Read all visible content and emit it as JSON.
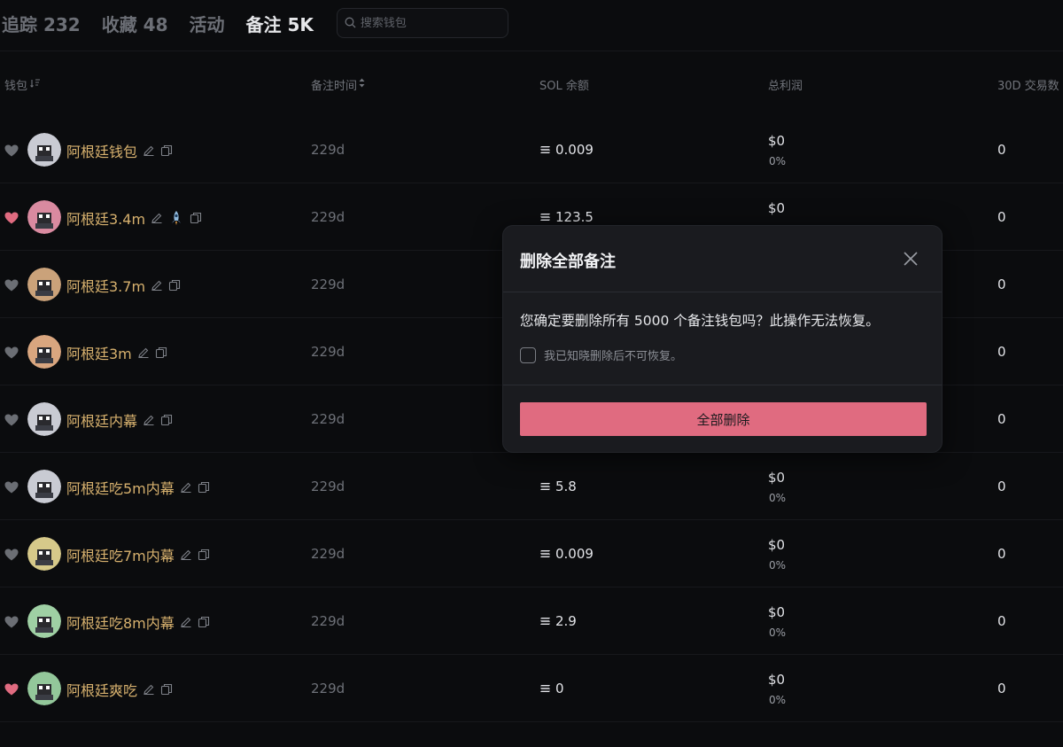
{
  "tabs": [
    {
      "label": "追踪 232"
    },
    {
      "label": "收藏 48"
    },
    {
      "label": "活动"
    },
    {
      "label": "备注 5K"
    }
  ],
  "search": {
    "placeholder": "搜索钱包"
  },
  "table": {
    "headers": {
      "wallet": "钱包",
      "note_time": "备注时间",
      "sol_balance": "SOL 余额",
      "total_profit": "总利润",
      "tx_30d": "30D 交易数"
    },
    "rows": [
      {
        "name": "阿根廷钱包",
        "note_time": "229d",
        "sol": "0.009",
        "profit": "$0",
        "profit_pct": "0%",
        "tx": "0",
        "favorited": false,
        "avatar_color": "#c9cbd3"
      },
      {
        "name": "阿根廷3.4m",
        "note_time": "229d",
        "sol": "123.5",
        "profit": "$0",
        "profit_pct": "",
        "tx": "0",
        "favorited": true,
        "avatar_color": "#d98aa0",
        "extra_badge": "rocket-badge"
      },
      {
        "name": "阿根廷3.7m",
        "note_time": "229d",
        "sol": "",
        "profit": "",
        "profit_pct": "",
        "tx": "0",
        "favorited": false,
        "avatar_color": "#caa27a"
      },
      {
        "name": "阿根廷3m",
        "note_time": "229d",
        "sol": "",
        "profit": "",
        "profit_pct": "",
        "tx": "0",
        "favorited": false,
        "avatar_color": "#d9a67f"
      },
      {
        "name": "阿根廷内幕",
        "note_time": "229d",
        "sol": "",
        "profit": "",
        "profit_pct": "",
        "tx": "0",
        "favorited": false,
        "avatar_color": "#c9cbd3"
      },
      {
        "name": "阿根廷吃5m内幕",
        "note_time": "229d",
        "sol": "5.8",
        "profit": "$0",
        "profit_pct": "0%",
        "tx": "0",
        "favorited": false,
        "avatar_color": "#c9cbd3"
      },
      {
        "name": "阿根廷吃7m内幕",
        "note_time": "229d",
        "sol": "0.009",
        "profit": "$0",
        "profit_pct": "0%",
        "tx": "0",
        "favorited": false,
        "avatar_color": "#d6c98a"
      },
      {
        "name": "阿根廷吃8m内幕",
        "note_time": "229d",
        "sol": "2.9",
        "profit": "$0",
        "profit_pct": "0%",
        "tx": "0",
        "favorited": false,
        "avatar_color": "#9fd0a4"
      },
      {
        "name": "阿根廷爽吃",
        "note_time": "229d",
        "sol": "0",
        "profit": "$0",
        "profit_pct": "0%",
        "tx": "0",
        "favorited": true,
        "avatar_color": "#93c79a"
      }
    ]
  },
  "modal": {
    "title": "删除全部备注",
    "message": "您确定要删除所有 5000 个备注钱包吗？此操作无法恢复。",
    "ack_label": "我已知晓删除后不可恢复。",
    "confirm_label": "全部删除"
  },
  "colors": {
    "background": "#0b0c0e",
    "wallet_name": "#d7b16e",
    "heart_active": "#e06b80",
    "heart_inactive": "#6b6e74",
    "danger_button": "#e06b80"
  }
}
